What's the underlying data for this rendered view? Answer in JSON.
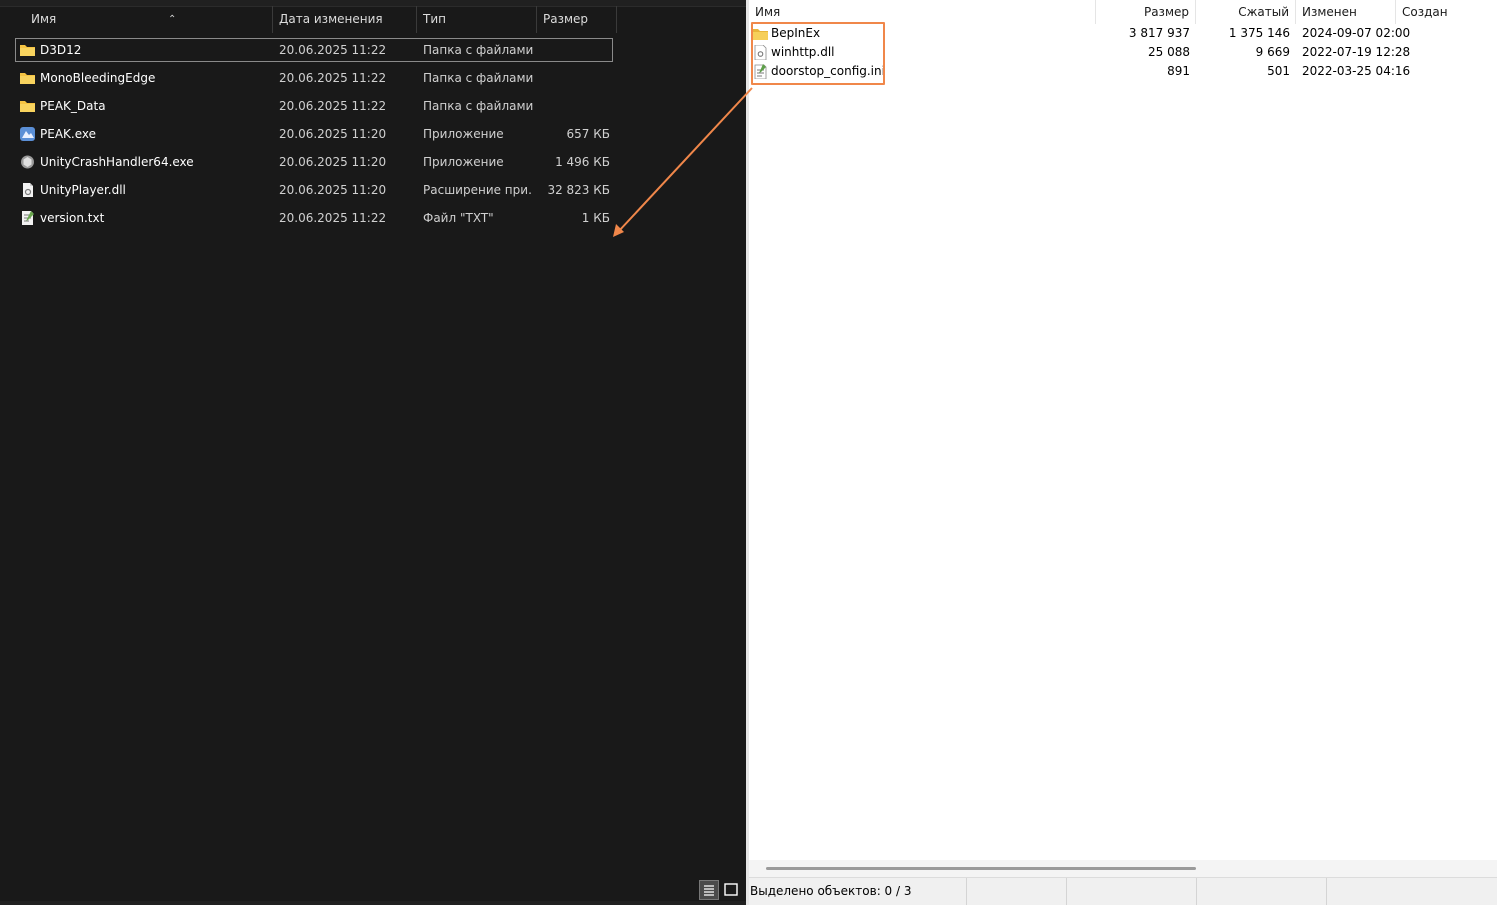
{
  "explorer": {
    "columns": {
      "name": "Имя",
      "date": "Дата изменения",
      "type": "Тип",
      "size": "Размер"
    },
    "files": [
      {
        "name": "D3D12",
        "date": "20.06.2025 11:22",
        "type": "Папка с файлами",
        "size": "",
        "icon": "folder-icon"
      },
      {
        "name": "MonoBleedingEdge",
        "date": "20.06.2025 11:22",
        "type": "Папка с файлами",
        "size": "",
        "icon": "folder-icon"
      },
      {
        "name": "PEAK_Data",
        "date": "20.06.2025 11:22",
        "type": "Папка с файлами",
        "size": "",
        "icon": "folder-icon"
      },
      {
        "name": "PEAK.exe",
        "date": "20.06.2025 11:20",
        "type": "Приложение",
        "size": "657 КБ",
        "icon": "app-icon"
      },
      {
        "name": "UnityCrashHandler64.exe",
        "date": "20.06.2025 11:20",
        "type": "Приложение",
        "size": "1 496 КБ",
        "icon": "unity-icon"
      },
      {
        "name": "UnityPlayer.dll",
        "date": "20.06.2025 11:20",
        "type": "Расширение при...",
        "size": "32 823 КБ",
        "icon": "dll-file-icon"
      },
      {
        "name": "version.txt",
        "date": "20.06.2025 11:22",
        "type": "Файл \"TXT\"",
        "size": "1 КБ",
        "icon": "text-file-icon"
      }
    ]
  },
  "archive": {
    "columns": {
      "name": "Имя",
      "size": "Размер",
      "packed": "Сжатый",
      "modified": "Изменен",
      "created": "Создан"
    },
    "files": [
      {
        "name": "BepInEx",
        "size": "3 817 937",
        "packed": "1 375 146",
        "modified": "2024-09-07 02:00",
        "icon": "folder-icon"
      },
      {
        "name": "winhttp.dll",
        "size": "25 088",
        "packed": "9 669",
        "modified": "2022-07-19 12:28",
        "icon": "dll-file-icon"
      },
      {
        "name": "doorstop_config.ini",
        "size": "891",
        "packed": "501",
        "modified": "2022-03-25 04:16",
        "icon": "ini-file-icon"
      }
    ],
    "status": "Выделено объектов: 0 / 3"
  },
  "colors": {
    "highlight": "#f0874a",
    "folder": "#f5c342",
    "dark_bg": "#191919"
  }
}
